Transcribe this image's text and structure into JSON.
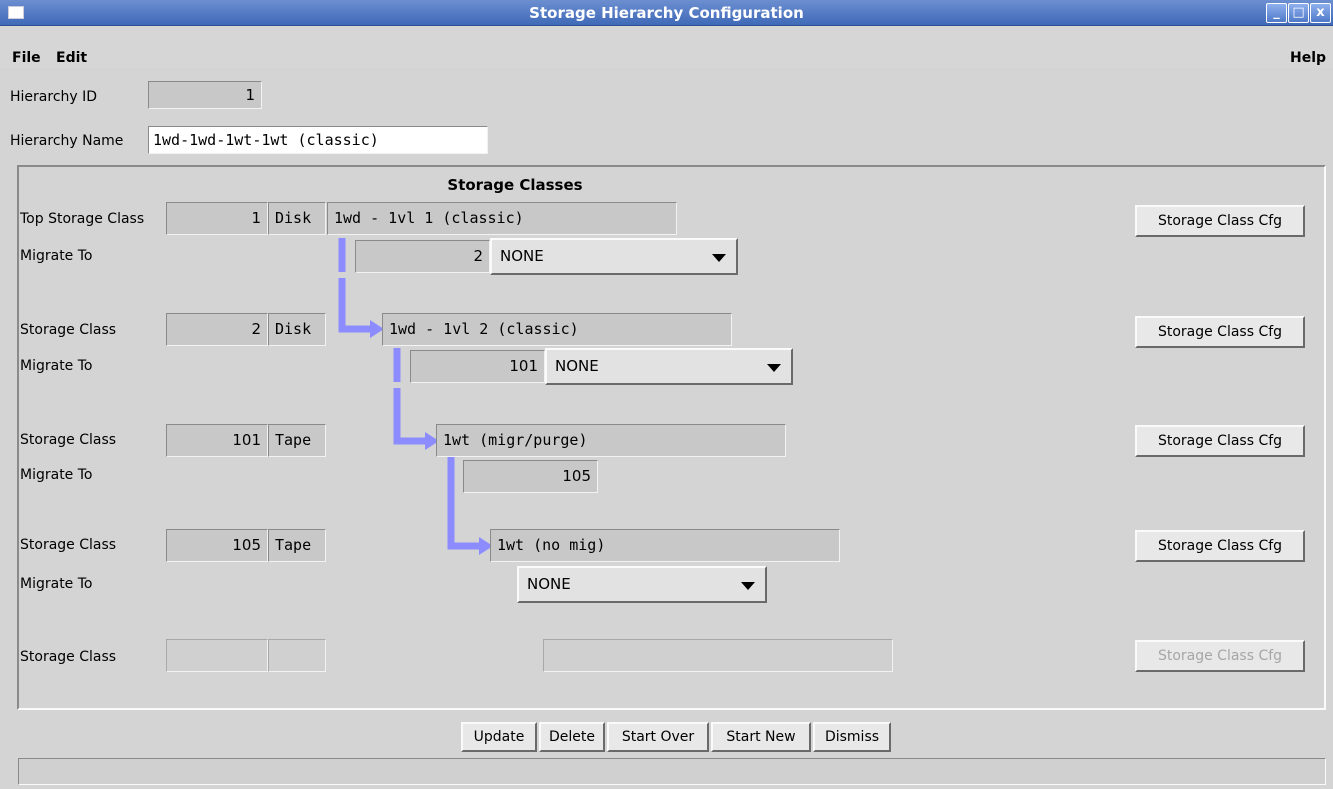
{
  "window": {
    "title": "Storage Hierarchy Configuration",
    "min_label": "_",
    "max_label": "□",
    "close_label": "x"
  },
  "menu": {
    "file": "File",
    "edit": "Edit",
    "help": "Help"
  },
  "hierarchy": {
    "id_label": "Hierarchy ID",
    "id_value": "1",
    "name_label": "Hierarchy Name",
    "name_value": "1wd-1wd-1wt-1wt (classic)"
  },
  "section_title": "Storage Classes",
  "cfg_button_label": "Storage Class Cfg",
  "migrate_label": "Migrate To",
  "rows": [
    {
      "label": "Top Storage Class",
      "id": "1",
      "media": "Disk",
      "name": "1wd - 1vl 1 (classic)",
      "migrate_id": "2",
      "migrate_policy": "NONE"
    },
    {
      "label": "Storage Class",
      "id": "2",
      "media": "Disk",
      "name": "1wd - 1vl 2 (classic)",
      "migrate_id": "101",
      "migrate_policy": "NONE"
    },
    {
      "label": "Storage Class",
      "id": "101",
      "media": "Tape",
      "name": "1wt (migr/purge)",
      "migrate_id": "105"
    },
    {
      "label": "Storage Class",
      "id": "105",
      "media": "Tape",
      "name": "1wt (no mig)",
      "migrate_policy": "NONE"
    },
    {
      "label": "Storage Class",
      "id": "",
      "media": "",
      "name": ""
    }
  ],
  "buttons": {
    "update": "Update",
    "delete": "Delete",
    "start_over": "Start Over",
    "start_new": "Start New",
    "dismiss": "Dismiss"
  },
  "status_text": "",
  "colors": {
    "arrow": "#8c8cff",
    "titlebar": "#4a72c0"
  }
}
